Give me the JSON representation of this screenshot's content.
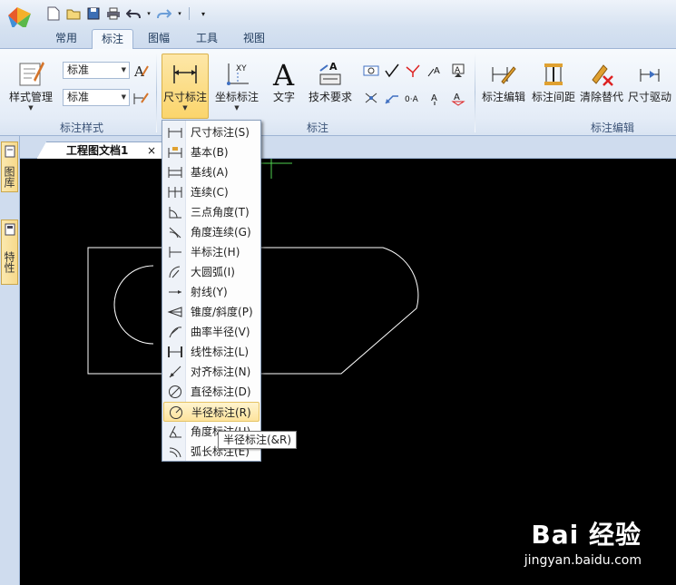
{
  "tabs": [
    "常用",
    "标注",
    "图幅",
    "工具",
    "视图"
  ],
  "active_tab": "标注",
  "ribbon": {
    "style_group": {
      "label": "标注样式",
      "manage_label": "样式管理",
      "combo1": "标准",
      "combo2": "标准"
    },
    "annotation_group": {
      "label": "标注",
      "dimension_label": "尺寸标注",
      "coordinate_label": "坐标标注",
      "text_label": "文字",
      "tech_label": "技术要求"
    },
    "edit_group": {
      "label": "标注编辑",
      "edit_label": "标注编辑",
      "spacing_label": "标注间距",
      "clear_label": "清除替代",
      "drive_label": "尺寸驱动"
    }
  },
  "side_tabs": [
    "图库",
    "特性"
  ],
  "document_tab": "工程图文档1",
  "menu_items": [
    "尺寸标注(S)",
    "基本(B)",
    "基线(A)",
    "连续(C)",
    "三点角度(T)",
    "角度连续(G)",
    "半标注(H)",
    "大圆弧(I)",
    "射线(Y)",
    "锥度/斜度(P)",
    "曲率半径(V)",
    "线性标注(L)",
    "对齐标注(N)",
    "直径标注(D)",
    "半径标注(R)",
    "角度标注(U)",
    "弧长标注(E)"
  ],
  "highlighted_item": "半径标注(R)",
  "tooltip": "半径标注(&R)",
  "watermark": "Bai 经验",
  "watermark_url": "jingyan.baidu.com"
}
